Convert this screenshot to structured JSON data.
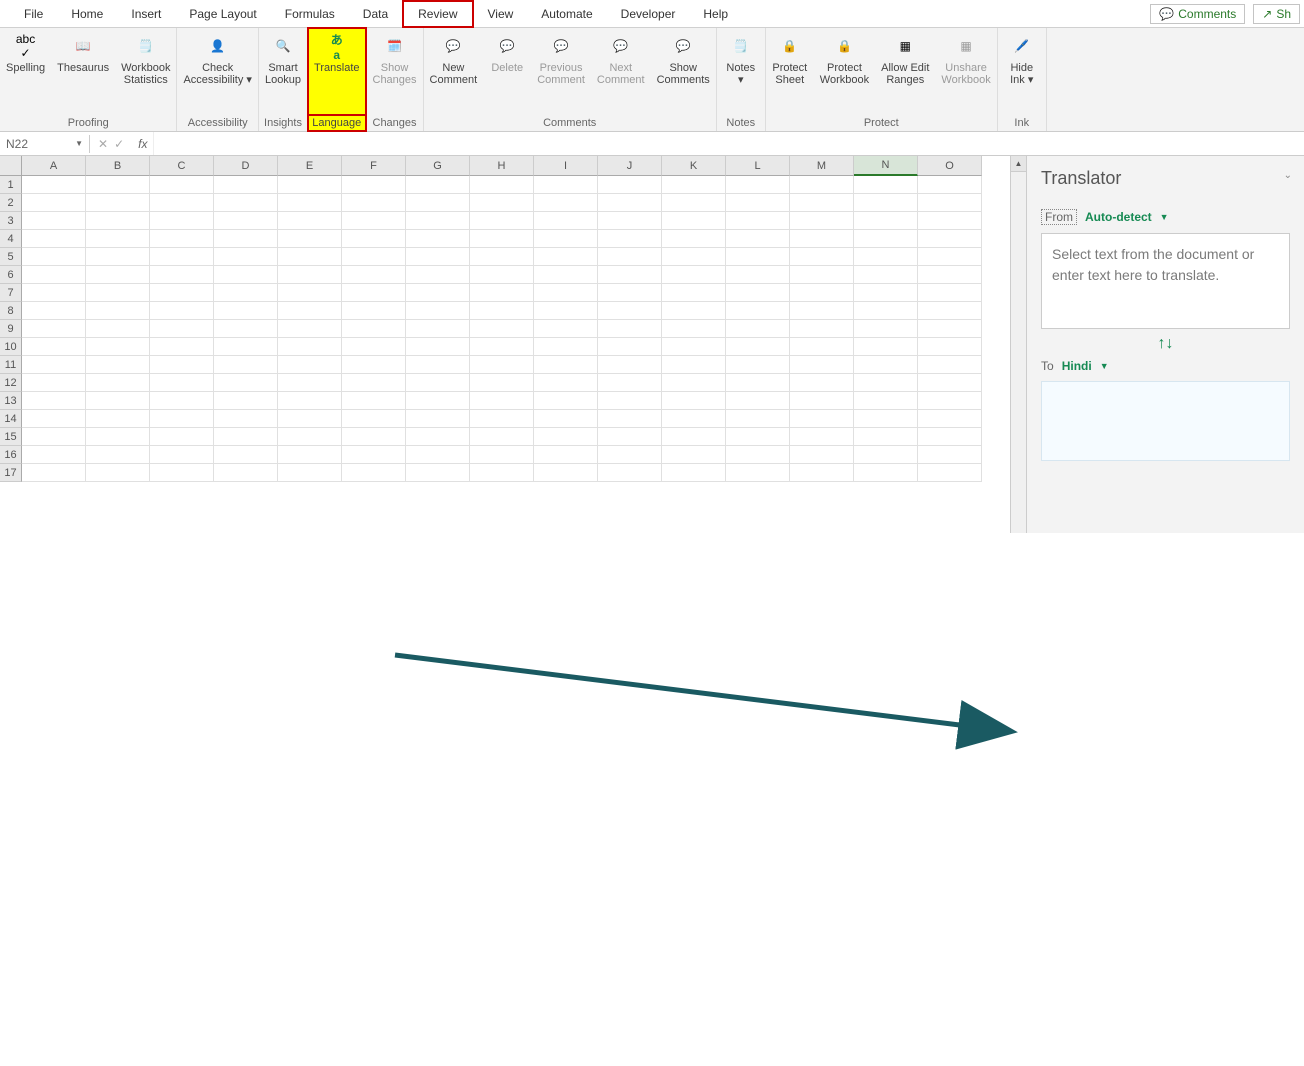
{
  "tabs": [
    "File",
    "Home",
    "Insert",
    "Page Layout",
    "Formulas",
    "Data",
    "Review",
    "View",
    "Automate",
    "Developer",
    "Help"
  ],
  "selected_tab": "Review",
  "right_buttons": {
    "comments": "Comments",
    "share": "Sh"
  },
  "ribbon": {
    "proofing": {
      "label": "Proofing",
      "spelling": "Spelling",
      "thesaurus": "Thesaurus",
      "workbook_stats": "Workbook\nStatistics"
    },
    "accessibility": {
      "label": "Accessibility",
      "check": "Check\nAccessibility"
    },
    "insights": {
      "label": "Insights",
      "smart_lookup": "Smart\nLookup"
    },
    "language": {
      "label": "Language",
      "translate": "Translate"
    },
    "changes": {
      "label": "Changes",
      "show_changes": "Show\nChanges"
    },
    "comments": {
      "label": "Comments",
      "new": "New\nComment",
      "delete": "Delete",
      "previous": "Previous\nComment",
      "next": "Next\nComment",
      "show": "Show\nComments"
    },
    "notes": {
      "label": "Notes",
      "notes": "Notes"
    },
    "protect": {
      "label": "Protect",
      "sheet": "Protect\nSheet",
      "workbook": "Protect\nWorkbook",
      "ranges": "Allow Edit\nRanges",
      "unshare": "Unshare\nWorkbook"
    },
    "ink": {
      "label": "Ink",
      "hide": "Hide\nInk"
    }
  },
  "namebox": "N22",
  "columns": [
    "A",
    "B",
    "C",
    "D",
    "E",
    "F",
    "G",
    "H",
    "I",
    "J",
    "K",
    "L",
    "M",
    "N",
    "O"
  ],
  "rows_visible": 17,
  "selected_col": "N",
  "pane": {
    "title": "Translator",
    "from_label": "From",
    "from_value": "Auto-detect",
    "placeholder": "Select text from the document or enter text here to translate.",
    "to_label": "To",
    "to_value": "Hindi"
  }
}
